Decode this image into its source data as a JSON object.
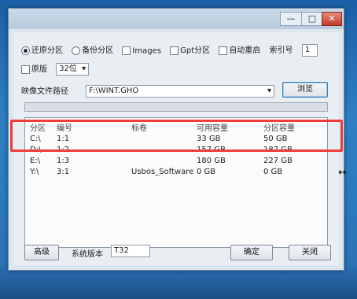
{
  "window": {
    "title_buttons": {
      "minimize": "—",
      "maximize": "□",
      "close": "✕"
    }
  },
  "options": {
    "restore_partition": "还原分区",
    "backup_partition": "备份分区",
    "images": "Images",
    "gpt_partition": "Gpt分区",
    "auto_restart": "自动重启",
    "index_label": "索引号",
    "index_value": "1",
    "original": "原版",
    "bits_value": "32位"
  },
  "image_path": {
    "label": "映像文件路径",
    "value": "F:\\WINT.GHO",
    "browse": "浏览"
  },
  "table": {
    "headers": [
      "分区",
      "编号",
      "标卷",
      "可用容量",
      "分区容量"
    ],
    "rows": [
      [
        "C:\\",
        "1:1",
        "",
        "33 GB",
        "50 GB"
      ],
      [
        "D:\\",
        "1:2",
        "",
        "157 GB",
        "187 GB"
      ],
      [
        "E:\\",
        "1:3",
        "",
        "180 GB",
        "227 GB"
      ],
      [
        "Y:\\",
        "3:1",
        "Usbos_Software",
        "0 GB",
        "0 GB"
      ]
    ]
  },
  "footer": {
    "advanced": "高级",
    "version_label": "系统版本",
    "version_value": "T32",
    "confirm": "确定",
    "close": "关闭"
  }
}
